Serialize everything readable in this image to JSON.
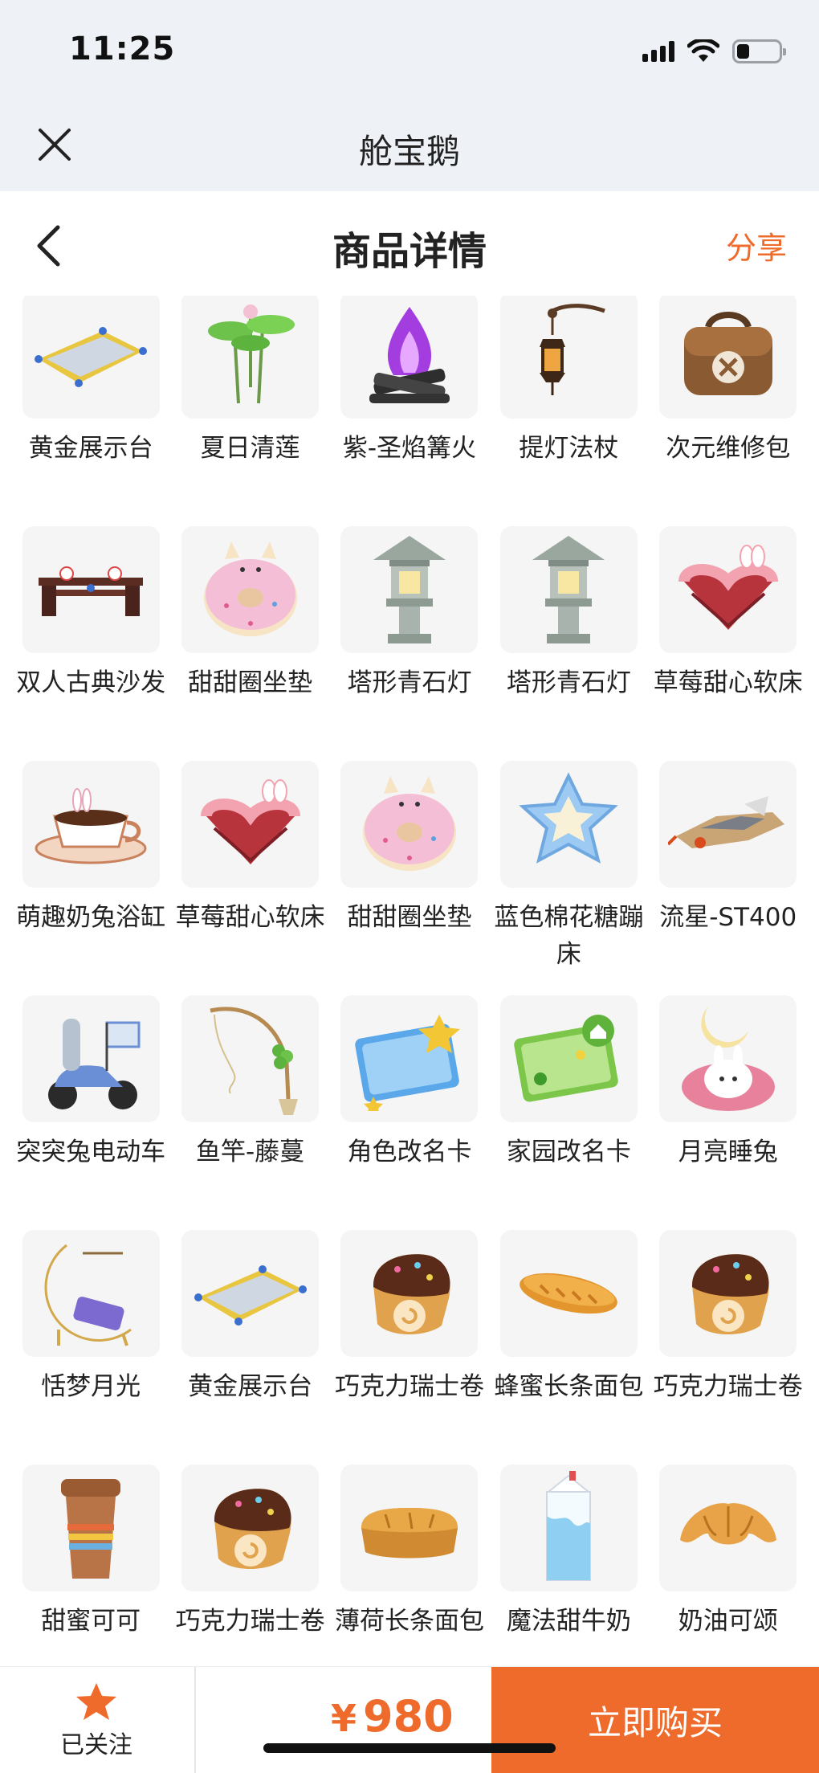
{
  "status_bar": {
    "time": "11:25"
  },
  "app_bar": {
    "title": "舱宝鹅"
  },
  "header": {
    "title": "商品详情",
    "share_label": "分享"
  },
  "items": [
    {
      "name": "黄金展示台",
      "icon": "golden-display-stand"
    },
    {
      "name": "夏日清莲",
      "icon": "lotus"
    },
    {
      "name": "紫-圣焰篝火",
      "icon": "purple-bonfire"
    },
    {
      "name": "提灯法杖",
      "icon": "lantern-staff"
    },
    {
      "name": "次元维修包",
      "icon": "repair-bag"
    },
    {
      "name": "双人古典沙发",
      "icon": "classic-sofa"
    },
    {
      "name": "甜甜圈坐垫",
      "icon": "donut-cushion"
    },
    {
      "name": "塔形青石灯",
      "icon": "stone-lantern"
    },
    {
      "name": "塔形青石灯",
      "icon": "stone-lantern"
    },
    {
      "name": "草莓甜心软床",
      "icon": "strawberry-bed"
    },
    {
      "name": "萌趣奶兔浴缸",
      "icon": "teacup-bathtub"
    },
    {
      "name": "草莓甜心软床",
      "icon": "strawberry-bed"
    },
    {
      "name": "甜甜圈坐垫",
      "icon": "donut-cushion"
    },
    {
      "name": "蓝色棉花糖蹦床",
      "icon": "marshmallow-trampoline"
    },
    {
      "name": "流星-ST400",
      "icon": "meteor-vehicle"
    },
    {
      "name": "突突兔电动车",
      "icon": "scooter"
    },
    {
      "name": "鱼竿-藤蔓",
      "icon": "fishing-rod"
    },
    {
      "name": "角色改名卡",
      "icon": "blue-rename-card"
    },
    {
      "name": "家园改名卡",
      "icon": "green-rename-card"
    },
    {
      "name": "月亮睡兔",
      "icon": "moon-bunny"
    },
    {
      "name": "恬梦月光",
      "icon": "moon-bed"
    },
    {
      "name": "黄金展示台",
      "icon": "golden-display-stand"
    },
    {
      "name": "巧克力瑞士卷",
      "icon": "swiss-roll"
    },
    {
      "name": "蜂蜜长条面包",
      "icon": "baguette"
    },
    {
      "name": "巧克力瑞士卷",
      "icon": "swiss-roll"
    },
    {
      "name": "甜蜜可可",
      "icon": "cocoa-cup"
    },
    {
      "name": "巧克力瑞士卷",
      "icon": "swiss-roll"
    },
    {
      "name": "薄荷长条面包",
      "icon": "bread-loaf"
    },
    {
      "name": "魔法甜牛奶",
      "icon": "milk-carton"
    },
    {
      "name": "奶油可颂",
      "icon": "croissant"
    }
  ],
  "bottom_bar": {
    "follow_label": "已关注",
    "currency": "¥",
    "price": "980",
    "buy_label": "立即购买"
  },
  "colors": {
    "accent": "#ee6b2c",
    "topbar_bg": "#eef2f6",
    "thumb_bg": "#f5f5f5"
  },
  "battery_level": 0.3
}
